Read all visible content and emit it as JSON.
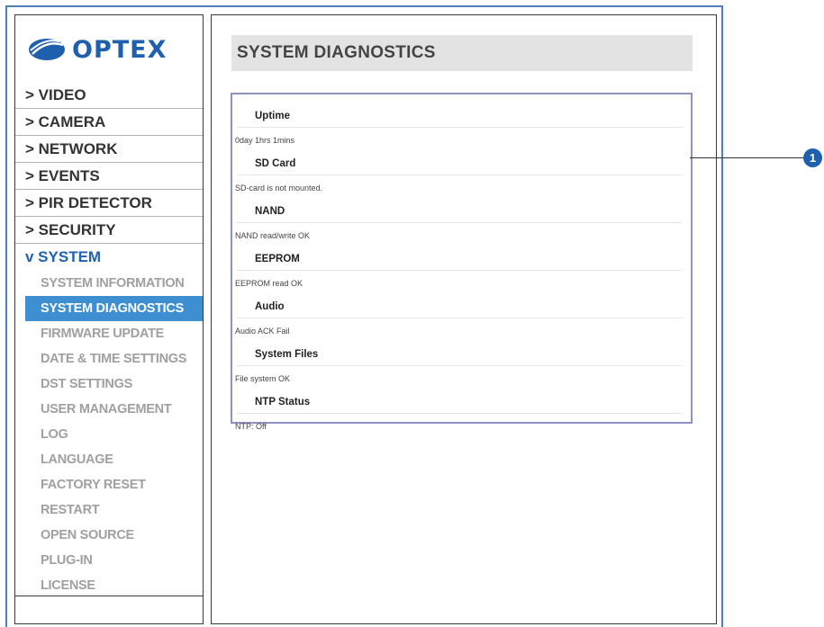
{
  "brand": {
    "name": "OPTEX",
    "color": "#1e5fae"
  },
  "sidebar": {
    "items": [
      {
        "label": "> VIDEO"
      },
      {
        "label": "> CAMERA"
      },
      {
        "label": "> NETWORK"
      },
      {
        "label": "> EVENTS"
      },
      {
        "label": "> PIR DETECTOR"
      },
      {
        "label": "> SECURITY"
      },
      {
        "label": "v SYSTEM"
      }
    ],
    "system_subitems": [
      {
        "label": "SYSTEM INFORMATION"
      },
      {
        "label": "SYSTEM DIAGNOSTICS"
      },
      {
        "label": "FIRMWARE UPDATE"
      },
      {
        "label": "DATE & TIME SETTINGS"
      },
      {
        "label": "DST SETTINGS"
      },
      {
        "label": "USER MANAGEMENT"
      },
      {
        "label": "LOG"
      },
      {
        "label": "LANGUAGE"
      },
      {
        "label": "FACTORY RESET"
      },
      {
        "label": "RESTART"
      },
      {
        "label": "OPEN SOURCE"
      },
      {
        "label": "PLUG-IN"
      },
      {
        "label": "LICENSE"
      }
    ],
    "selected_color": "#3d8fd1"
  },
  "main": {
    "title": "SYSTEM DIAGNOSTICS",
    "diagnostics": [
      {
        "heading": "Uptime",
        "value": "0day 1hrs 1mins"
      },
      {
        "heading": "SD Card",
        "value": "SD-card is not mounted."
      },
      {
        "heading": "NAND",
        "value": "NAND read/write OK"
      },
      {
        "heading": "EEPROM",
        "value": "EEPROM read OK"
      },
      {
        "heading": "Audio",
        "value": "Audio ACK Fail"
      },
      {
        "heading": "System Files",
        "value": "File system OK"
      },
      {
        "heading": "NTP Status",
        "value": "NTP: Off"
      }
    ]
  },
  "callout": {
    "number": "1"
  }
}
